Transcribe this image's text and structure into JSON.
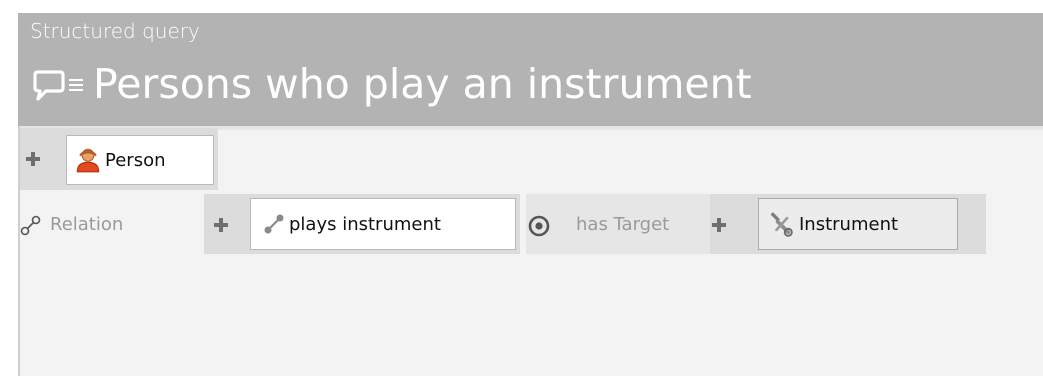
{
  "header": {
    "subtitle": "Structured query",
    "title": "Persons who play an instrument",
    "icons": [
      "query-bubble-icon",
      "menu-lines-icon"
    ]
  },
  "query": {
    "root_concept": {
      "label": "Person",
      "icon": "person-icon"
    },
    "relation_row": {
      "label": "Relation",
      "relation": {
        "label": "plays instrument",
        "icon": "relation-link-icon"
      },
      "target_label": "has Target",
      "target_concept": {
        "label": "Instrument",
        "icon": "wrench-icon"
      }
    }
  },
  "colors": {
    "header_bg": "#b3b3b3",
    "content_bg": "#f3f3f3",
    "plus": "#6f6f6f",
    "muted_text": "#9a9a9a"
  }
}
